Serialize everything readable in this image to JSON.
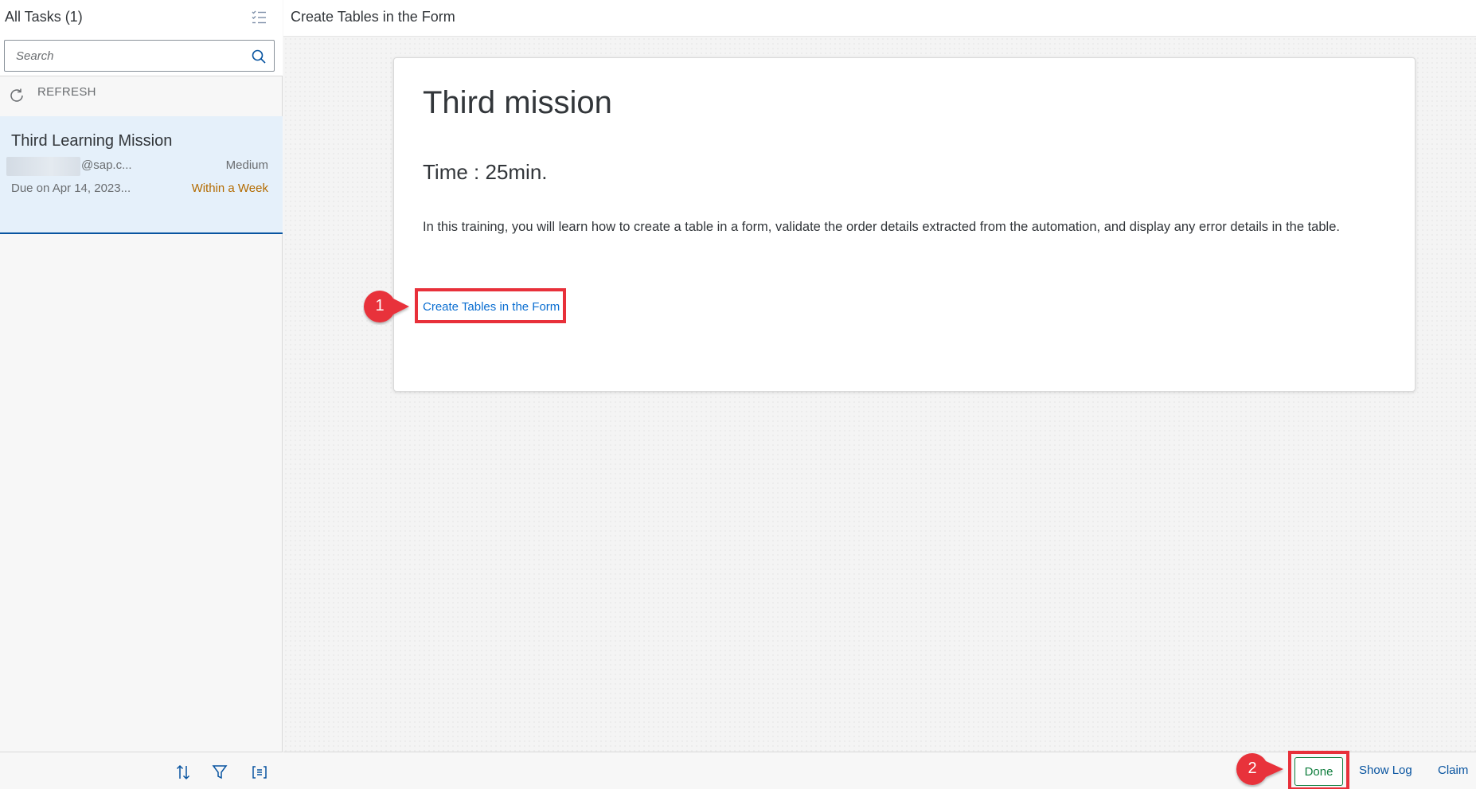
{
  "master": {
    "title": "All Tasks (1)",
    "search_placeholder": "Search",
    "refresh_label": "REFRESH",
    "tasks": [
      {
        "title": "Third Learning Mission",
        "creator": "@sap.c...",
        "priority": "Medium",
        "due": "Due on Apr 14, 2023...",
        "status": "Within a Week"
      }
    ],
    "footer_icons": [
      "sort-icon",
      "filter-icon",
      "group-icon"
    ]
  },
  "detail": {
    "header_title": "Create Tables in the Form",
    "heading": "Third mission",
    "time": "Time : 25min.",
    "description": "In this training, you will learn how to create a table in a form, validate the order details extracted from the automation, and display any error details in the table.",
    "link_text": "Create Tables in the Form",
    "callouts": [
      "1",
      "2"
    ],
    "footer": {
      "done_label": "Done",
      "show_log_label": "Show Log",
      "claim_label": "Claim"
    }
  },
  "colors": {
    "selection_bg": "#e5f0fa",
    "selection_border": "#0854a0",
    "link": "#0a6ed1",
    "status_warning": "#b36b00",
    "accept_green": "#107e3e",
    "highlight_red": "#e8303a"
  }
}
